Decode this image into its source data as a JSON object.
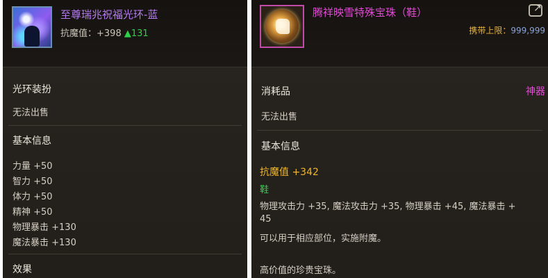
{
  "left": {
    "title": "至尊瑞兆祝福光环-蓝",
    "stat_label": "抗魔值：",
    "stat_value": "+398",
    "bonus": "▲131",
    "category": "光环装扮",
    "sell_status": "无法出售",
    "section_basic": "基本信息",
    "attributes": [
      "力量 +50",
      "智力 +50",
      "体力 +50",
      "精神 +50",
      "物理暴击 +130",
      "魔法暴击 +130"
    ],
    "section_effect": "效果",
    "icon": "aura-icon"
  },
  "right": {
    "title": "腾祥映雪特殊宝珠（鞋）",
    "carry_label": "携带上限：",
    "carry_value": "999,999",
    "category": "消耗品",
    "rarity": "神器",
    "sell_status": "无法出售",
    "section_basic": "基本信息",
    "stat_main": "抗魔值 +342",
    "slot": "鞋",
    "effects_line1": "物理攻击力 +35, 魔法攻击力 +35, 物理暴击 +45, 魔法暴击 +",
    "effects_line2": "45",
    "usage": "可以用于相应部位，实施附魔。",
    "description": "高价值的珍贵宝珠。",
    "icon": "orb-boot-icon",
    "share_icon": "share-icon"
  },
  "colors": {
    "title_left": "#b57cf0",
    "title_right": "#e448d6",
    "gold": "#f0b62c",
    "green": "#33d24d",
    "rarity": "#e448d6"
  }
}
